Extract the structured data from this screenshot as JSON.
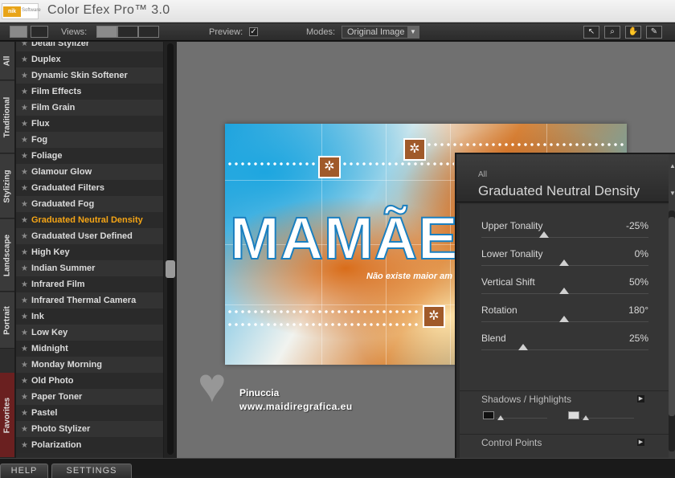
{
  "app": {
    "logo_text": "nik",
    "logo_sub": "Software",
    "title": "Color Efex Pro™ 3.0"
  },
  "toolbar": {
    "views_label": "Views:",
    "preview_label": "Preview:",
    "preview_checked": "✓",
    "modes_label": "Modes:",
    "mode_value": "Original Image"
  },
  "tabs": [
    "All",
    "Traditional",
    "Stylizing",
    "Landscape",
    "Portrait",
    "Favorites"
  ],
  "filters": [
    "Detail Stylizer",
    "Duplex",
    "Dynamic Skin Softener",
    "Film Effects",
    "Film Grain",
    "Flux",
    "Fog",
    "Foliage",
    "Glamour Glow",
    "Graduated Filters",
    "Graduated Fog",
    "Graduated Neutral Density",
    "Graduated User Defined",
    "High Key",
    "Indian Summer",
    "Infrared Film",
    "Infrared Thermal Camera",
    "Ink",
    "Low Key",
    "Midnight",
    "Monday Morning",
    "Old Photo",
    "Paper Toner",
    "Pastel",
    "Photo Stylizer",
    "Polarization"
  ],
  "active_filter": "Graduated Neutral Density",
  "image": {
    "headline": "MAMÃE",
    "subtitle": "Não existe maior am"
  },
  "watermark": {
    "name": "Pinuccia",
    "url": "www.maidiregrafica.eu"
  },
  "panel": {
    "category": "All",
    "title": "Graduated Neutral Density",
    "sliders": [
      {
        "label": "Upper Tonality",
        "value": "-25%",
        "position": 0.38
      },
      {
        "label": "Lower Tonality",
        "value": "0%",
        "position": 0.5
      },
      {
        "label": "Vertical Shift",
        "value": "50%",
        "position": 0.5
      },
      {
        "label": "Rotation",
        "value": "180°",
        "position": 0.5
      },
      {
        "label": "Blend",
        "value": "25%",
        "position": 0.25
      }
    ],
    "shadows_label": "Shadows / Highlights",
    "control_points_label": "Control Points"
  },
  "bottom": {
    "help": "HELP",
    "settings": "SETTINGS"
  },
  "colors": {
    "accent": "#f5a516",
    "panel_bg": "#353535",
    "canvas_bg": "#707070"
  }
}
